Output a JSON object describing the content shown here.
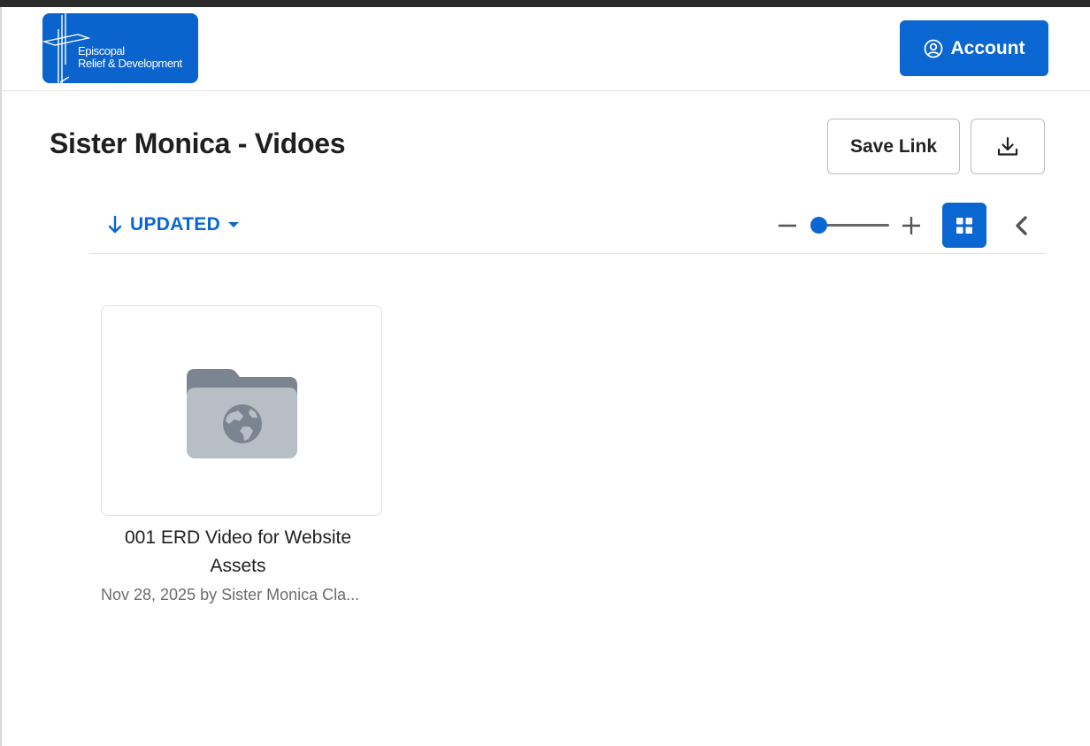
{
  "header": {
    "logo_line1": "Episcopal",
    "logo_line2": "Relief & Development",
    "account_label": "Account"
  },
  "page": {
    "title": "Sister Monica - Vidoes",
    "save_link_label": "Save Link"
  },
  "toolbar": {
    "sort_label": "UPDATED",
    "sort_direction": "descending",
    "zoom_level": 0,
    "view_mode": "grid"
  },
  "items": [
    {
      "type": "folder",
      "icon": "folder-globe-icon",
      "name": "001 ERD Video for Website Assets",
      "meta": "Nov 28, 2025 by Sister Monica Cla..."
    }
  ],
  "colors": {
    "accent": "#0a66d0",
    "logo_bg": "#0b63ce",
    "folder_body": "#b8bec6",
    "folder_tab": "#7b8591"
  }
}
